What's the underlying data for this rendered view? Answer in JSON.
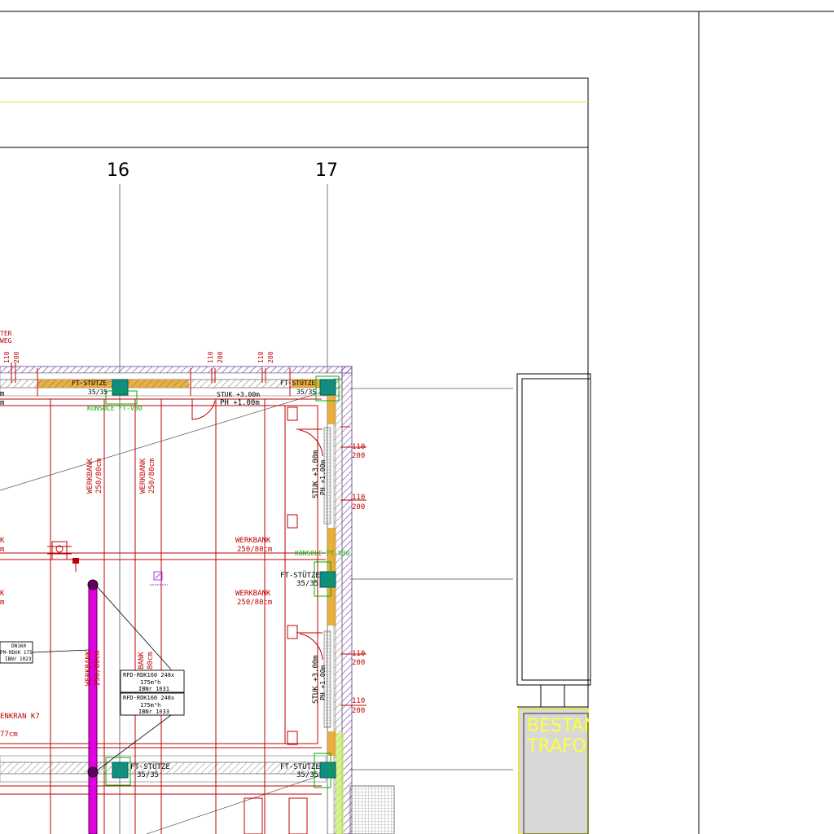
{
  "axes": {
    "axis_16": "16",
    "axis_17": "17"
  },
  "top_wall": {
    "label_left_fragment": "TER\nWEG",
    "dims_a": [
      "110",
      "200"
    ],
    "dims_b": [
      "110",
      "200"
    ],
    "dims_c": [
      "110",
      "200"
    ],
    "stuetze_left": "FT-STÜTZE",
    "stuetze_left_size": "35/35",
    "stuetze_right": "FT-STÜTZE",
    "stuetze_right_size": "35/35",
    "konsole": "KONSOLE FT-V30",
    "stuk_top": "STUK +3.00m",
    "ph_top": "PH +1.00m",
    "frag_m": "m"
  },
  "right_wall": {
    "dim_pairs": [
      [
        "110",
        "200"
      ],
      [
        "110",
        "200"
      ],
      [
        "110",
        "200"
      ],
      [
        "110",
        "200"
      ]
    ],
    "stuk_upper": "STUK +3.00m",
    "ph_upper": "PH +1.00m",
    "stuk_lower": "STUK +3.00m",
    "ph_lower": "PH +1.00m",
    "konsole": "KONSOLE FT-V30",
    "stuetze_mid": "FT-STÜTZE",
    "stuetze_mid_size": "35/35",
    "stuetze_bot": "FT-STÜTZE",
    "stuetze_bot_size": "35/35"
  },
  "benches": {
    "v1_name": "WERKBANK",
    "v1_size": "250/80cm",
    "v2_name": "WERKBANK",
    "v2_size": "250/80cm",
    "h1_name": "WERKBANK",
    "h1_size": "250/80cm",
    "h2_name": "WERKBANK",
    "h2_size": "250/80cm",
    "frag_k1": "K",
    "frag_m1": "m",
    "frag_k2": "K",
    "frag_m2": "m",
    "v3_name": "WERKBANK",
    "v3_size": "250/80cm",
    "v4_name": "BANK",
    "v4_size": "80cm"
  },
  "crane": {
    "label": "ENKRAN K7",
    "size": "77cm"
  },
  "device_tags": {
    "tag1_line1": "RFD-RDK160 248x",
    "tag1_line2": "175m³h",
    "tag1_line3": "IBNr 1031",
    "tag2_line1": "RFD-RDK160 248x",
    "tag2_line2": "175m³h",
    "tag2_line3": "IBNr 1033",
    "tag_left_line1": "DN160",
    "tag_left_line2": "FM-RDUK 175",
    "tag_left_line3": "IBNr 1023"
  },
  "bottom": {
    "stuetze_left": "FT-STÜTZE",
    "stuetze_left_size": "35/35",
    "stuetze_right": "FT-STÜTZE",
    "stuetze_right_size": "35/35"
  },
  "trafo": {
    "line1": "BESTAND",
    "line2": "TRAFO"
  },
  "colors": {
    "red": "#c00000",
    "green": "#00b000",
    "magenta": "#e000e0",
    "teal": "#118e80",
    "yellow": "#ffff3a",
    "orange": "#e8a020",
    "purple": "#9a62c8",
    "grey": "#d0d0d0"
  }
}
